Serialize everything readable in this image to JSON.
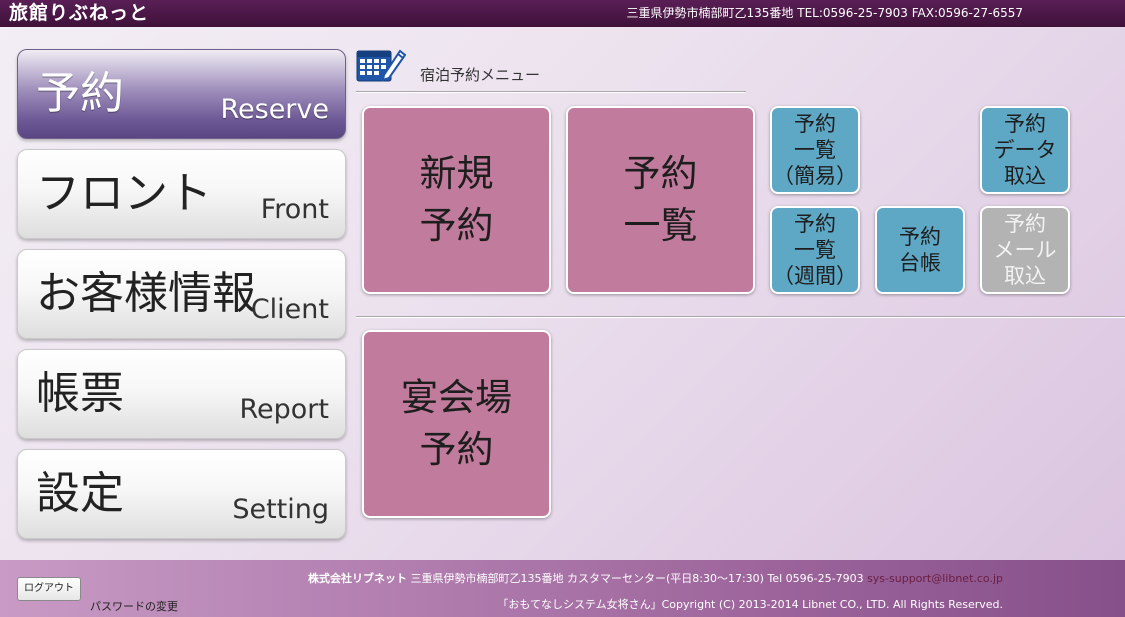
{
  "header": {
    "app_title": "旅館りぶねっと",
    "contact": "三重県伊勢市楠部町乙135番地 TEL:0596-25-7903 FAX:0596-27-6557"
  },
  "sidebar": {
    "items": [
      {
        "jp": "予約",
        "en": "Reserve",
        "active": true
      },
      {
        "jp": "フロント",
        "en": "Front",
        "active": false
      },
      {
        "jp": "お客様情報",
        "en": "Client",
        "active": false
      },
      {
        "jp": "帳票",
        "en": "Report",
        "active": false
      },
      {
        "jp": "設定",
        "en": "Setting",
        "active": false
      }
    ]
  },
  "menu": {
    "icon": "calendar-edit-icon",
    "title": "宿泊予約メニュー"
  },
  "tiles": {
    "new_reservation": "新規\n予約",
    "reservation_list": "予約\n一覧",
    "list_simple": "予約\n一覧\n（簡易）",
    "list_weekly": "予約\n一覧\n（週間）",
    "ledger": "予約\n台帳",
    "data_import": "予約\nデータ\n取込",
    "mail_import": "予約\nメール\n取込",
    "banquet_reservation": "宴会場\n予約"
  },
  "footer": {
    "logout_label": "ログアウト",
    "password_link": "パスワードの変更",
    "company": "株式会社リブネット",
    "address": " 三重県伊勢市楠部町乙135番地 カスタマーセンター(平日8:30～17:30) Tel 0596-25-7903 ",
    "email": "sys-support@libnet.co.jp",
    "copyright": "「おもてなしシステム女将さん」Copyright (C) 2013-2014 Libnet CO., LTD. All Rights Reserved."
  },
  "colors": {
    "header_bg": "#3e1139",
    "tile_large": "#c07b9d",
    "tile_small": "#5ea8c6",
    "tile_disabled": "#b3b3b3",
    "sidebar_active": "#6c5895"
  }
}
